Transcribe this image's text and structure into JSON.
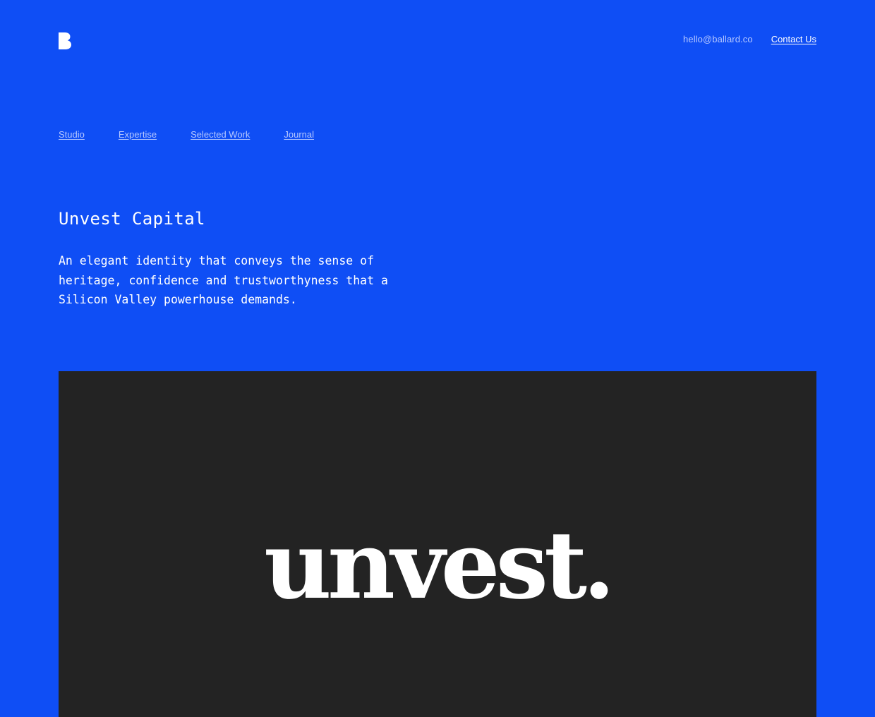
{
  "brand": {
    "logo_icon": "ballard-b-logo-icon",
    "accent_color": "#0f4ef5",
    "text_color": "#ffffff"
  },
  "header": {
    "email": "hello@ballard.co",
    "contact_label": "Contact Us"
  },
  "nav": {
    "items": [
      {
        "label": "Studio"
      },
      {
        "label": "Expertise"
      },
      {
        "label": "Selected Work"
      },
      {
        "label": "Journal"
      }
    ]
  },
  "project": {
    "title": "Unvest Capital",
    "description": "An elegant identity that conveys the sense of heritage, confidence and trustworthyness that a Silicon Valley powerhouse demands.",
    "showcase_bg": "#232323",
    "wordmark": "unvest."
  }
}
